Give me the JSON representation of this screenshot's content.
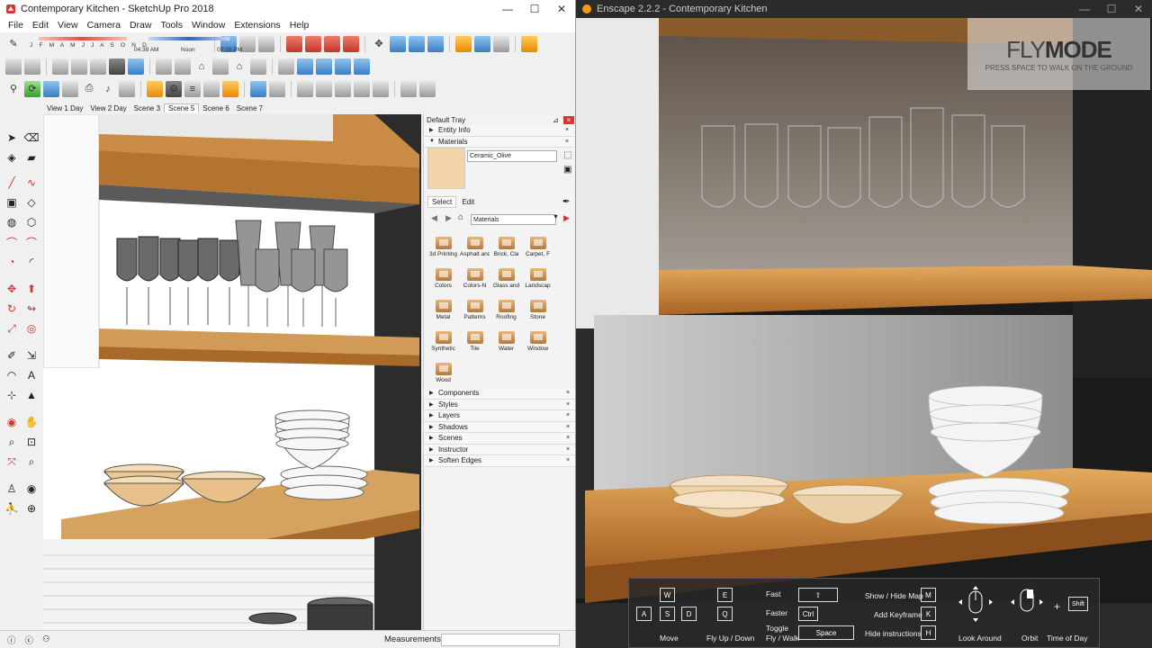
{
  "sketchup": {
    "title": "Contemporary Kitchen - SketchUp Pro 2018",
    "window_controls": [
      "—",
      "☐",
      "✕"
    ],
    "menu": [
      "File",
      "Edit",
      "View",
      "Camera",
      "Draw",
      "Tools",
      "Window",
      "Extensions",
      "Help"
    ],
    "timeline": {
      "months": "J F M A M J J A S O N D",
      "time_start": "04:38 AM",
      "time_mid": "Noon",
      "time_end": "07:28 PM"
    },
    "scenes": [
      "View 1 Day",
      "View 2 Day",
      "Scene 3",
      "Scene 5",
      "Scene 6",
      "Scene 7"
    ],
    "active_scene": "Scene 5",
    "tray": {
      "title": "Default Tray",
      "sections_top": [
        "Entity Info",
        "Materials"
      ],
      "material_name": "Ceramic_Olive",
      "material_color": "#f2d4a9",
      "tabs": [
        "Select",
        "Edit"
      ],
      "library": "Materials",
      "folders": [
        "3d Printing",
        "Asphalt and",
        "Brick, Cla",
        "Carpet, F",
        "Colors",
        "Colors-N",
        "Glass and",
        "Landscap",
        "Metal",
        "Patterns",
        "Roofing",
        "Stone",
        "Synthetic",
        "Tile",
        "Water",
        "Window",
        "Wood"
      ],
      "sections_bottom": [
        "Components",
        "Styles",
        "Layers",
        "Shadows",
        "Scenes",
        "Instructor",
        "Soften Edges"
      ]
    },
    "status": {
      "measurements": "Measurements"
    }
  },
  "enscape": {
    "title": "Enscape 2.2.2 - Contemporary Kitchen",
    "window_controls": [
      "—",
      "☐",
      "✕"
    ],
    "flymode": {
      "title_a": "FLY",
      "title_b": "MODE",
      "subtitle": "PRESS SPACE TO WALK ON THE GROUND"
    },
    "hud": {
      "keys": {
        "w": "W",
        "a": "A",
        "s": "S",
        "d": "D",
        "e": "E",
        "q": "Q",
        "ctrl": "Ctrl",
        "space": "Space",
        "m": "M",
        "k": "K",
        "h": "H",
        "shift": "Shift",
        "shift_arrow": "⇧"
      },
      "labels": {
        "move": "Move",
        "fly": "Fly Up / Down",
        "fast": "Fast",
        "faster": "Faster",
        "toggle1": "Toggle",
        "toggle2": "Fly / Walk",
        "map": "Show / Hide Map",
        "keyframe": "Add Keyframe",
        "hide": "Hide instructions",
        "look": "Look Around",
        "orbit": "Orbit",
        "time": "Time of Day",
        "plus": "+"
      }
    }
  }
}
